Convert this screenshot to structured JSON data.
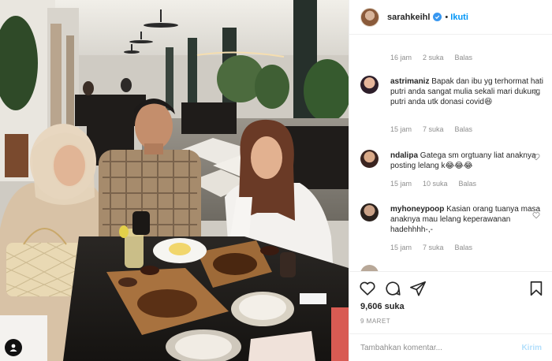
{
  "header": {
    "username": "sarahkeihl",
    "separator": "•",
    "follow_label": "Ikuti"
  },
  "comments": [
    {
      "username": "",
      "text": "",
      "time": "16 jam",
      "likes": "2 suka",
      "reply": "Balas"
    },
    {
      "username": "astrimaniz",
      "text": "Bapak dan ibu yg terhormat hati putri anda sangat mulia sekali mari dukung putri anda utk donasi covid😆",
      "time": "15 jam",
      "likes": "7 suka",
      "reply": "Balas"
    },
    {
      "username": "ndalipa",
      "text": "Gatega sm orgtuany liat anaknya posting lelang k😂😂😂",
      "time": "15 jam",
      "likes": "10 suka",
      "reply": "Balas"
    },
    {
      "username": "myhoneypoop",
      "text": "Kasian orang tuanya masa anaknya mau lelang keperawanan hadehhhh-,-",
      "time": "15 jam",
      "likes": "7 suka",
      "reply": "Balas"
    }
  ],
  "actions": {
    "likes_count": "9,606 suka",
    "date": "9 MARET"
  },
  "comment_box": {
    "placeholder": "Tambahkan komentar...",
    "post_label": "Kirim"
  },
  "colors": {
    "accent": "#0095f6",
    "verified": "#3897f0",
    "muted": "#8e8e8e",
    "post_disabled": "#b2dffc"
  }
}
